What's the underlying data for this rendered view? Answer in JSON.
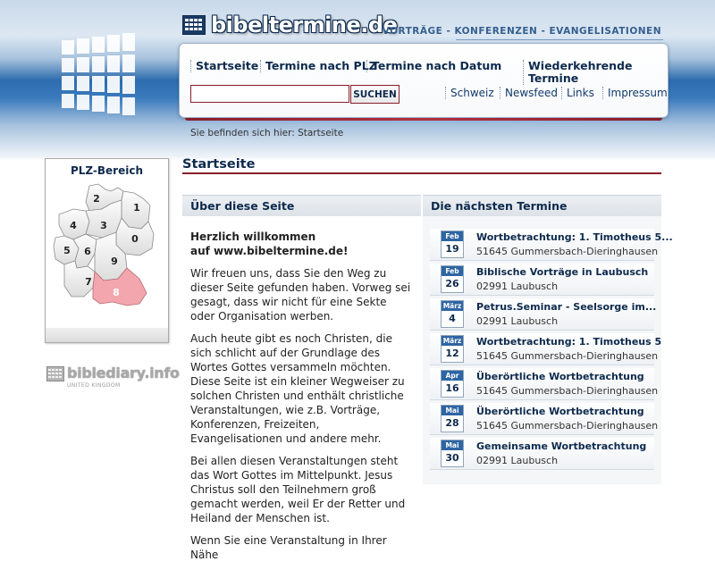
{
  "header": {
    "site_title": "bibeltermine.de",
    "tagline": "VORTRÄGE - KONFERENZEN - EVANGELISATIONEN"
  },
  "nav": {
    "main": [
      "Startseite",
      "Termine nach PLZ",
      "Termine nach Datum",
      "Wiederkehrende Termine"
    ],
    "sub": [
      "Schweiz",
      "Newsfeed",
      "Links",
      "Impressum"
    ]
  },
  "search": {
    "value": "",
    "button_label": "SUCHEN"
  },
  "breadcrumb": "Sie befinden sich hier: Startseite",
  "sidebar": {
    "plz_title": "PLZ-Bereich",
    "regions": [
      "0",
      "1",
      "2",
      "3",
      "4",
      "5",
      "6",
      "7",
      "8",
      "9"
    ],
    "active_region": "8",
    "partner_logo": "biblediary.info",
    "partner_sub": "UNITED KINGDOM"
  },
  "main": {
    "page_title": "Startseite",
    "about_heading": "Über diese Seite",
    "events_heading": "Die nächsten Termine",
    "greeting_line1": "Herzlich willkommen",
    "greeting_line2": "auf www.bibeltermine.de!",
    "paragraphs": [
      "Wir freuen uns, dass Sie den Weg zu dieser Seite gefunden haben. Vorweg sei gesagt, dass wir nicht für eine Sekte oder Organisation werben.",
      "Auch heute gibt es noch Christen, die sich schlicht auf der Grundlage des Wortes Gottes versammeln möchten. Diese Seite ist ein kleiner Wegweiser zu solchen Christen und enthält christliche Veranstaltungen, wie z.B. Vorträge, Konferenzen, Freizeiten, Evangelisationen und andere mehr.",
      "Bei allen diesen Veranstaltungen steht das Wort Gottes im Mittelpunkt. Jesus Christus soll den Teilnehmern groß gemacht werden, weil Er der Retter und Heiland der Menschen ist.",
      "Wenn Sie eine Veranstaltung in Ihrer Nähe"
    ]
  },
  "events": [
    {
      "month": "Feb",
      "day": "19",
      "title": "Wortbetrachtung: 1. Timotheus 5...",
      "place": "51645 Gummersbach-Dieringhausen"
    },
    {
      "month": "Feb",
      "day": "26",
      "title": "Biblische Vorträge in Laubusch",
      "place": "02991 Laubusch"
    },
    {
      "month": "März",
      "day": "4",
      "title": "Petrus.Seminar - Seelsorge im...",
      "place": "02991 Laubusch"
    },
    {
      "month": "März",
      "day": "12",
      "title": "Wortbetrachtung: 1. Timotheus 5",
      "place": "51645 Gummersbach-Dieringhausen"
    },
    {
      "month": "Apr",
      "day": "16",
      "title": "Überörtliche Wortbetrachtung",
      "place": "51645 Gummersbach-Dieringhausen"
    },
    {
      "month": "Mai",
      "day": "28",
      "title": "Überörtliche Wortbetrachtung",
      "place": "51645 Gummersbach-Dieringhausen"
    },
    {
      "month": "Mai",
      "day": "30",
      "title": "Gemeinsame Wortbetrachtung",
      "place": "02991 Laubusch"
    }
  ],
  "colors": {
    "brand_dark": "#0d2a4d",
    "accent_red": "#8a1d2a",
    "calendar_blue": "#2e65a3",
    "active_region": "#f3a6ad"
  }
}
